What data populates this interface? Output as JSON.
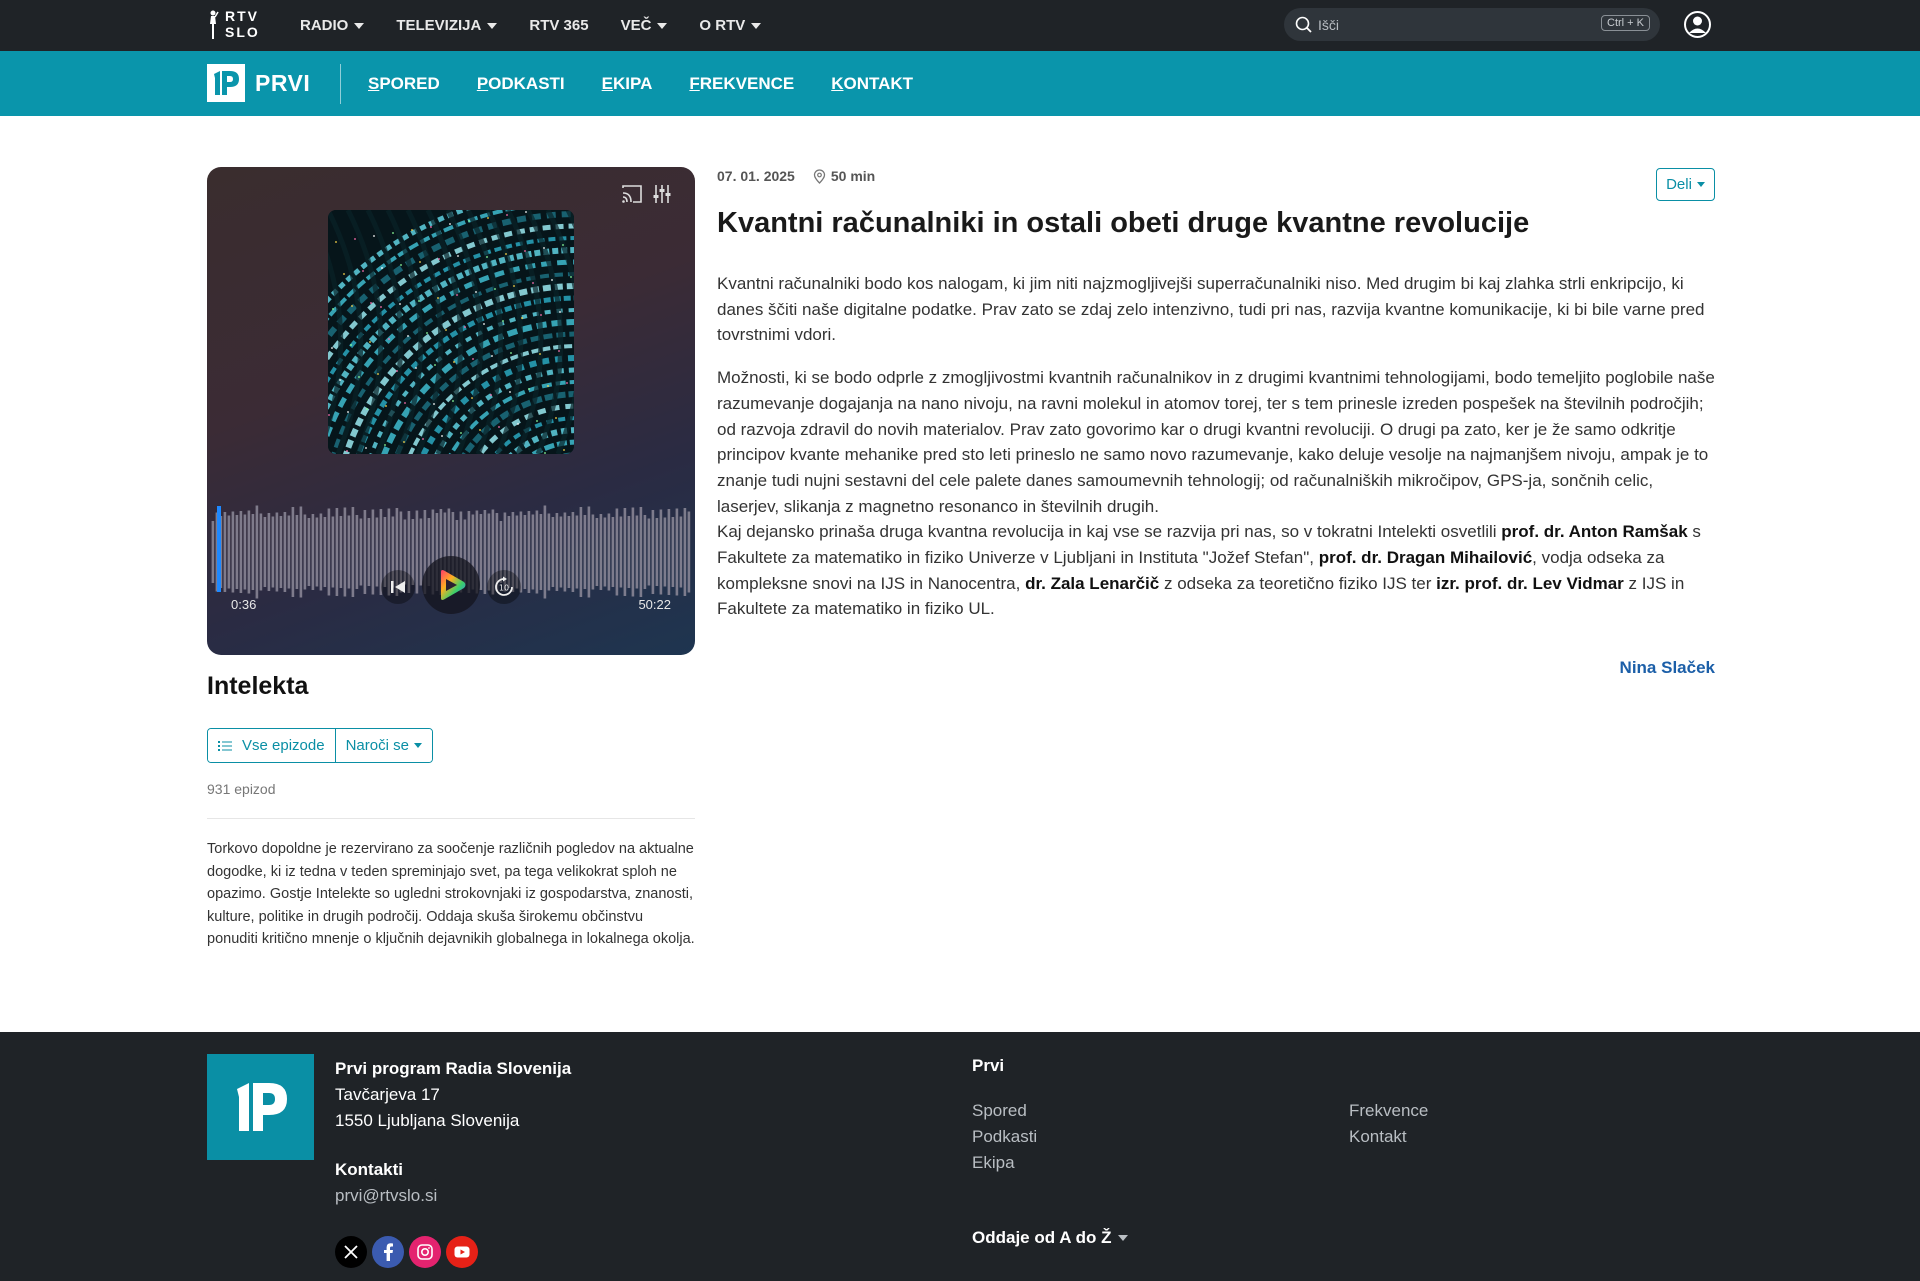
{
  "topbar": {
    "logo_line1": "RTV",
    "logo_line2": "SLO",
    "nav": [
      {
        "label": "RADIO",
        "dropdown": true
      },
      {
        "label": "TELEVIZIJA",
        "dropdown": true
      },
      {
        "label": "RTV 365",
        "dropdown": false
      },
      {
        "label": "VEČ",
        "dropdown": true
      },
      {
        "label": "O RTV",
        "dropdown": true
      }
    ],
    "search_placeholder": "Išči",
    "search_shortcut": "Ctrl + K",
    "user_icon": "user-circle-icon"
  },
  "subbar": {
    "brand": "PRVI",
    "nav": [
      "SPORED",
      "PODKASTI",
      "EKIPA",
      "FREKVENCE",
      "KONTAKT"
    ]
  },
  "player": {
    "current_time": "0:36",
    "total_time": "50:22",
    "progress": 0.012,
    "icons": [
      "cast-icon",
      "equalizer-icon",
      "skip-back-icon",
      "play-icon",
      "forward-10-icon"
    ]
  },
  "show": {
    "title": "Intelekta",
    "all_episodes": "Vse epizode",
    "subscribe": "Naroči se",
    "episode_count": "931 epizod",
    "description": "Torkovo dopoldne je rezervirano za soočenje različnih pogledov na aktualne dogodke, ki iz tedna v teden spreminjajo svet, pa tega velikokrat sploh ne opazimo. Gostje Intelekte so ugledni strokovnjaki iz gospodarstva, znanosti, kulture, politike in drugih področij. Oddaja skuša širokemu občinstvu ponuditi kritično mnenje o ključnih dejavnikih globalnega in lokalnega okolja."
  },
  "episode": {
    "date": "07. 01. 2025",
    "duration": "50 min",
    "share": "Deli",
    "title": "Kvantni računalniki in ostali obeti druge kvantne revolucije",
    "paragraph1": "Kvantni računalniki bodo kos nalogam, ki jim niti najzmogljivejši superračunalniki niso. Med drugim bi kaj zlahka strli enkripcijo, ki danes ščiti naše digitalne podatke. Prav zato se zdaj zelo intenzivno, tudi pri nas, razvija kvantne komunikacije, ki bi bile varne pred tovrstnimi vdori.",
    "paragraph2": "Možnosti, ki se bodo odprle z zmogljivostmi kvantnih računalnikov in z drugimi kvantnimi tehnologijami, bodo temeljito poglobile naše razumevanje dogajanja na nano nivoju, na ravni molekul in atomov torej, ter s tem prinesle izreden pospešek na številnih področjih; od razvoja zdravil do novih materialov. Prav zato govorimo kar o drugi kvantni revoluciji. O drugi pa zato, ker je že samo odkritje principov kvante mehanike pred sto leti prineslo ne samo novo razumevanje, kako deluje vesolje na najmanjšem nivoju, ampak je to znanje tudi nujni sestavni del cele palete danes samoumevnih tehnologij; od računalniških mikročipov, GPS-ja, sončnih celic, laserjev, slikanja z magnetno resonanco in številnih drugih.",
    "p3_a": "Kaj dejansko prinaša druga kvantna revolucija in kaj vse se razvija pri nas, so v tokratni Intelekti osvetlili ",
    "p3_b": "prof. dr. Anton Ramšak",
    "p3_c": " s Fakultete za matematiko in fiziko Univerze v Ljubljani in Instituta \"Jožef Stefan\", ",
    "p3_d": "prof. dr. Dragan Mihailović",
    "p3_e": ", vodja odseka za kompleksne snovi na IJS in Nanocentra, ",
    "p3_f": "dr. Zala Lenarčič",
    "p3_g": " z odseka za teoretično fiziko IJS ter ",
    "p3_h": "izr. prof. dr. Lev Vidmar",
    "p3_i": " z IJS in Fakultete za matematiko in fiziko UL.",
    "author": "Nina Slaček"
  },
  "footer": {
    "org_name": "Prvi program Radia Slovenija",
    "street": "Tavčarjeva 17",
    "city": "1550 Ljubljana Slovenija",
    "contacts_heading": "Kontakti",
    "email": "prvi@rtvslo.si",
    "socials": [
      "x-icon",
      "facebook-icon",
      "instagram-icon",
      "youtube-icon"
    ],
    "links_heading": "Prvi",
    "links_col1": [
      "Spored",
      "Podkasti",
      "Ekipa"
    ],
    "links_col2": [
      "Frekvence",
      "Kontakt"
    ],
    "shows_az": "Oddaje od A do Ž"
  },
  "colors": {
    "topbar": "#1f2327",
    "brand_teal": "#0a95ab",
    "link_blue": "#1c5fa8"
  }
}
